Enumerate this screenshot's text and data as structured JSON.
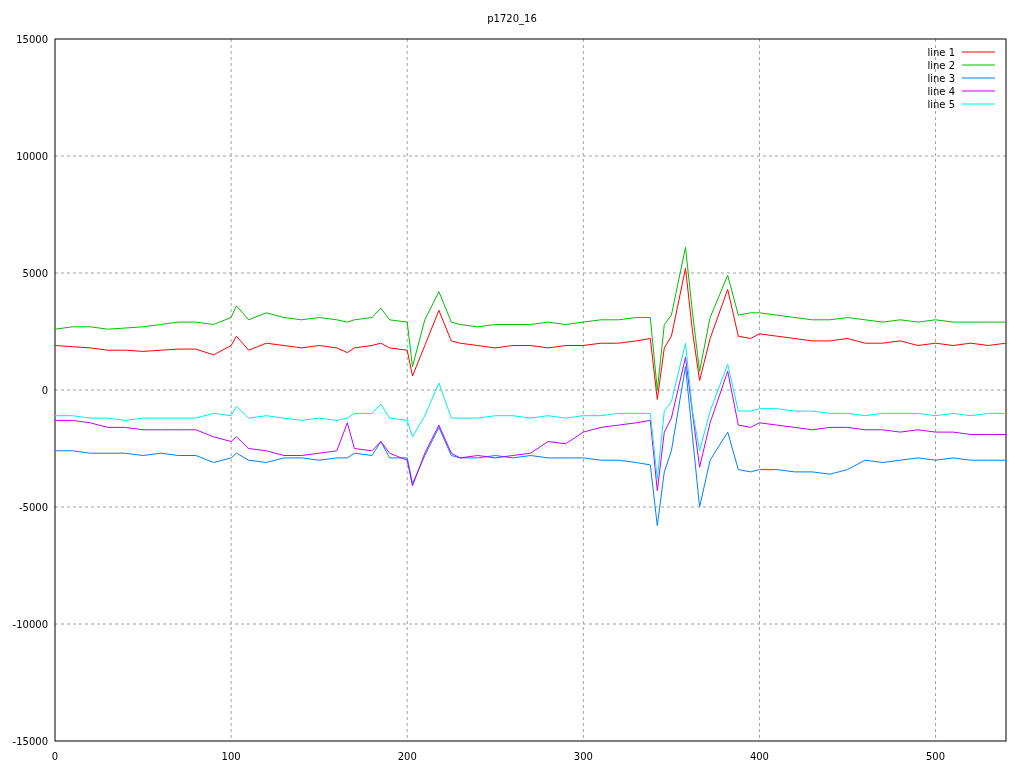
{
  "chart_data": {
    "type": "line",
    "title": "p1720_16",
    "x": [
      0,
      10,
      20,
      30,
      40,
      50,
      60,
      70,
      80,
      90,
      100,
      103,
      110,
      120,
      130,
      140,
      150,
      160,
      166,
      170,
      180,
      185,
      190,
      200,
      203,
      210,
      218,
      225,
      230,
      240,
      250,
      260,
      270,
      280,
      290,
      300,
      310,
      320,
      330,
      338,
      342,
      346,
      350,
      358,
      362,
      366,
      372,
      382,
      388,
      395,
      400,
      410,
      420,
      430,
      440,
      450,
      460,
      470,
      480,
      490,
      500,
      510,
      520,
      530,
      540
    ],
    "series": [
      {
        "name": "line 1",
        "color": "#ff0000",
        "values": [
          1900,
          1850,
          1800,
          1700,
          1700,
          1650,
          1700,
          1750,
          1750,
          1500,
          1900,
          2300,
          1700,
          2000,
          1900,
          1800,
          1900,
          1800,
          1600,
          1800,
          1900,
          2000,
          1800,
          1700,
          600,
          1900,
          3400,
          2100,
          2000,
          1900,
          1800,
          1900,
          1900,
          1800,
          1900,
          1900,
          2000,
          2000,
          2100,
          2200,
          -400,
          1800,
          2300,
          5200,
          2500,
          400,
          2200,
          4300,
          2300,
          2200,
          2400,
          2300,
          2200,
          2100,
          2100,
          2200,
          2000,
          2000,
          2100,
          1900,
          2000,
          1900,
          2000,
          1900,
          2000
        ]
      },
      {
        "name": "line 2",
        "color": "#00c000",
        "values": [
          2600,
          2700,
          2700,
          2600,
          2650,
          2700,
          2800,
          2900,
          2900,
          2800,
          3100,
          3600,
          3000,
          3300,
          3100,
          3000,
          3100,
          3000,
          2900,
          3000,
          3100,
          3500,
          3000,
          2900,
          1000,
          3000,
          4200,
          2900,
          2800,
          2700,
          2800,
          2800,
          2800,
          2900,
          2800,
          2900,
          3000,
          3000,
          3100,
          3100,
          0,
          2800,
          3200,
          6100,
          3300,
          800,
          3100,
          4900,
          3200,
          3300,
          3300,
          3200,
          3100,
          3000,
          3000,
          3100,
          3000,
          2900,
          3000,
          2900,
          3000,
          2900,
          2900,
          2900,
          2900
        ]
      },
      {
        "name": "line 3",
        "color": "#0080ff",
        "values": [
          -2600,
          -2600,
          -2700,
          -2700,
          -2700,
          -2800,
          -2700,
          -2800,
          -2800,
          -3100,
          -2900,
          -2700,
          -3000,
          -3100,
          -2900,
          -2900,
          -3000,
          -2900,
          -2900,
          -2700,
          -2800,
          -2200,
          -2900,
          -2900,
          -4000,
          -2800,
          -1600,
          -2800,
          -2900,
          -2900,
          -2800,
          -2900,
          -2800,
          -2900,
          -2900,
          -2900,
          -3000,
          -3000,
          -3100,
          -3200,
          -5800,
          -3500,
          -2600,
          1000,
          -2000,
          -5000,
          -3000,
          -1800,
          -3400,
          -3500,
          -3400,
          -3400,
          -3500,
          -3500,
          -3600,
          -3400,
          -3000,
          -3100,
          -3000,
          -2900,
          -3000,
          -2900,
          -3000,
          -3000,
          -3000
        ]
      },
      {
        "name": "line 4",
        "color": "#c000ff",
        "values": [
          -1300,
          -1300,
          -1400,
          -1600,
          -1600,
          -1700,
          -1700,
          -1700,
          -1700,
          -2000,
          -2200,
          -2000,
          -2500,
          -2600,
          -2800,
          -2800,
          -2700,
          -2600,
          -1400,
          -2500,
          -2600,
          -2200,
          -2700,
          -3000,
          -4100,
          -2700,
          -1500,
          -2700,
          -2900,
          -2800,
          -2900,
          -2800,
          -2700,
          -2200,
          -2300,
          -1800,
          -1600,
          -1500,
          -1400,
          -1300,
          -4300,
          -1800,
          -1200,
          1400,
          -1000,
          -3300,
          -1400,
          800,
          -1500,
          -1600,
          -1400,
          -1500,
          -1600,
          -1700,
          -1600,
          -1600,
          -1700,
          -1700,
          -1800,
          -1700,
          -1800,
          -1800,
          -1900,
          -1900,
          -1900
        ]
      },
      {
        "name": "line 5",
        "color": "#00eeee",
        "values": [
          -1100,
          -1100,
          -1200,
          -1200,
          -1300,
          -1200,
          -1200,
          -1200,
          -1200,
          -1000,
          -1100,
          -700,
          -1200,
          -1100,
          -1200,
          -1300,
          -1200,
          -1300,
          -1200,
          -1000,
          -1000,
          -600,
          -1200,
          -1300,
          -2000,
          -1100,
          300,
          -1200,
          -1200,
          -1200,
          -1100,
          -1100,
          -1200,
          -1100,
          -1200,
          -1100,
          -1100,
          -1000,
          -1000,
          -1000,
          -3800,
          -900,
          -500,
          2000,
          -900,
          -2600,
          -900,
          1100,
          -900,
          -900,
          -800,
          -800,
          -900,
          -900,
          -1000,
          -1000,
          -1100,
          -1000,
          -1000,
          -1000,
          -1100,
          -1000,
          -1100,
          -1000,
          -1000
        ]
      }
    ],
    "xlim": [
      0,
      540
    ],
    "ylim": [
      -15000,
      15000
    ],
    "xticks": [
      0,
      100,
      200,
      300,
      400,
      500
    ],
    "yticks": [
      -15000,
      -10000,
      -5000,
      0,
      5000,
      10000,
      15000
    ],
    "grid": true,
    "legend": true
  }
}
